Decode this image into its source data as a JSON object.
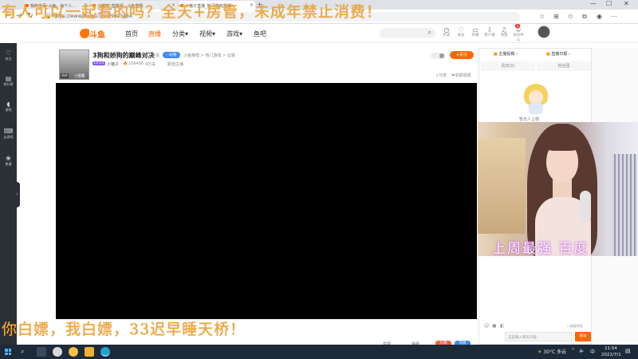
{
  "browser": {
    "tabs": [
      {
        "label": "我的主页_斗鱼 · 每个人…"
      },
      {
        "label": "小猪子_直播间 · 斗鱼直播"
      },
      {
        "label": "小猪子直播_热门游戏直播…"
      }
    ],
    "url": "https://www.douyu.com/9023484"
  },
  "site": {
    "logo_text": "斗鱼",
    "nav": [
      "首页",
      "直播",
      "分类",
      "视频",
      "游戏",
      "鱼吧"
    ],
    "header_icons": [
      "历史",
      "关注",
      "开播",
      "客户端",
      "消息",
      "会员中心"
    ],
    "notification_count": "1"
  },
  "leftbar": {
    "items": [
      "关注",
      "排行榜",
      "游戏",
      "云游戏",
      "鱼塘"
    ]
  },
  "room": {
    "title": "3狗和娇狗的巅峰对决",
    "report": "举报",
    "tag": "一起看",
    "category": "斗鱼推荐 > 热门游戏 > 云端",
    "level": "Lv.13",
    "streamer": "小猪子",
    "heat": "106406",
    "fans": "4万关",
    "rank": "颜值主播",
    "avatar_tag1": "热榜",
    "avatar_tag2": "一起看",
    "follow_label": "关注",
    "share_label": "分享",
    "report_error_label": "举报视频"
  },
  "rightpanel": {
    "tabs": [
      "主播投稿",
      "直播日报"
    ],
    "subtabs": [
      "贵宾(0)",
      "粉丝团"
    ],
    "mascot_caption": "暂无人上榜",
    "input_placeholder": "这里输入聊天内容",
    "send_label": "发送",
    "block_label": "屏蔽特效"
  },
  "below_video": {
    "items": [
      "举报",
      "弹幕",
      "礼物",
      "充值"
    ]
  },
  "overlays": {
    "top": "有人可以一起看的吗？全天+房管，未成年禁止消费！",
    "bottom": "你白嫖，我白嫖，33迟早睡天桥！",
    "cam_caption": "上周最强 百度"
  },
  "taskbar": {
    "weather": "30°C 多云",
    "input_method": "中",
    "time": "11:54",
    "date": "2022/7/1"
  }
}
